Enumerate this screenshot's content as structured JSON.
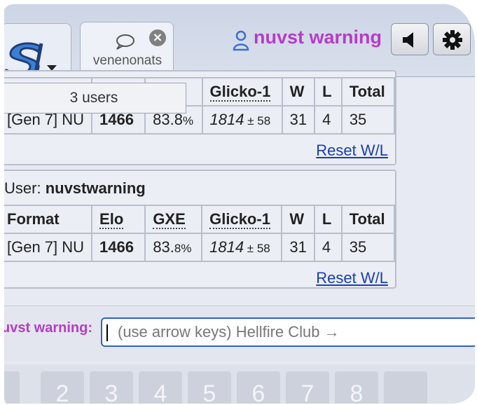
{
  "header": {
    "room_tab_label": "venenonats",
    "room_close_glyph": "×",
    "user_name": "nuvst warning",
    "user_name_color": "#b53cc6"
  },
  "popup": {
    "users_count": "3 users"
  },
  "block1": {
    "headers": [
      "Glicko-1",
      "W",
      "L",
      "Total"
    ],
    "row": {
      "format": "[Gen 7] NU",
      "elo": "1466",
      "gxe_main": "83.8",
      "gxe_small": "%",
      "glicko_main": "1814",
      "glicko_small": " ± 58",
      "w": "31",
      "l": "4",
      "total": "35"
    },
    "reset_label": "Reset W/L"
  },
  "block2": {
    "user_prefix": "User: ",
    "user_name": "nuvstwarning",
    "headers": [
      "Format",
      "Elo",
      "GXE",
      "Glicko-1",
      "W",
      "L",
      "Total"
    ],
    "row": {
      "format": "[Gen 7] NU",
      "elo": "1466",
      "gxe_main": "83.",
      "gxe_small": "8%",
      "glicko_main": "1814",
      "glicko_small": " ± 58",
      "w": "31",
      "l": "4",
      "total": "35"
    },
    "reset_label": "Reset W/L"
  },
  "composer": {
    "label": "uvst warning:",
    "placeholder": "(use arrow keys) Hellfire Club →"
  },
  "num_keys": [
    "",
    "2",
    "3",
    "4",
    "5",
    "6",
    "7",
    "8",
    ""
  ],
  "colors": {
    "accent": "#2d64c5",
    "link": "#1a3db8",
    "name": "#b53cc6"
  },
  "icons": [
    "logo-icon",
    "chevron-down-icon",
    "chat-bubble-icon",
    "close-icon",
    "user-icon",
    "speaker-icon",
    "gear-icon"
  ]
}
